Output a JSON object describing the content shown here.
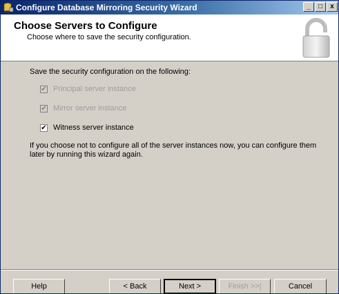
{
  "window": {
    "title": "Configure Database Mirroring Security Wizard",
    "controls": {
      "minimize": "_",
      "maximize": "□",
      "close": "x"
    }
  },
  "header": {
    "title": "Choose Servers to Configure",
    "subtitle": "Choose where to save the security configuration.",
    "icon": "padlock-icon"
  },
  "content": {
    "prompt": "Save the security configuration on the following:",
    "options": [
      {
        "label": "Principal server instance",
        "checked": true,
        "enabled": false
      },
      {
        "label": "Mirror server instance",
        "checked": true,
        "enabled": false
      },
      {
        "label": "Witness server instance",
        "checked": true,
        "enabled": true
      }
    ],
    "info": "If you choose not to configure all of the server instances now, you can configure them later by running this wizard again."
  },
  "footer": {
    "help": "Help",
    "back": "< Back",
    "next": "Next >",
    "finish": "Finish >>|",
    "cancel": "Cancel"
  },
  "colors": {
    "titlebar_start": "#0a246a",
    "titlebar_end": "#a6caf0",
    "face": "#d4d0c8"
  }
}
